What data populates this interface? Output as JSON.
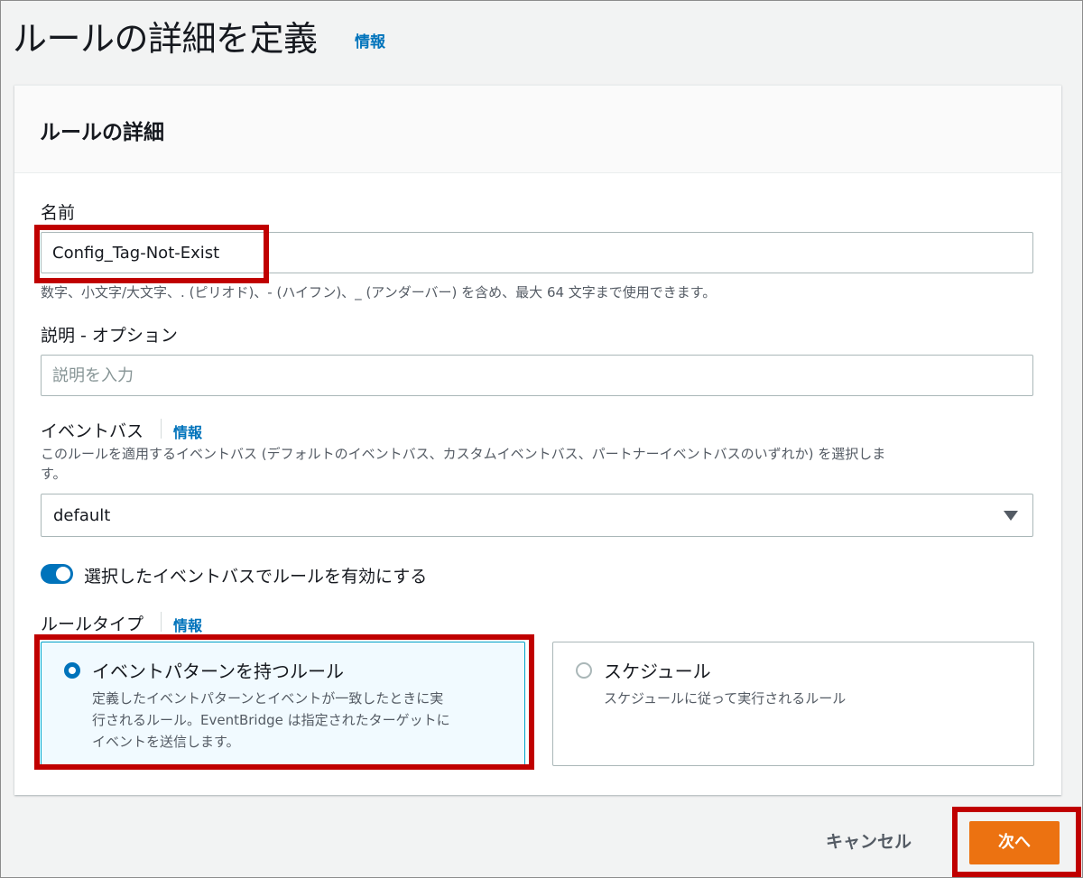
{
  "page": {
    "title": "ルールの詳細を定義",
    "info_link": "情報"
  },
  "panel": {
    "title": "ルールの詳細",
    "name": {
      "label": "名前",
      "value": "Config_Tag-Not-Exist",
      "constraint": "数字、小文字/大文字、. (ピリオド)、- (ハイフン)、_ (アンダーバー) を含め、最大 64 文字まで使用できます。"
    },
    "description": {
      "label": "説明 - オプション",
      "placeholder": "説明を入力"
    },
    "event_bus": {
      "label": "イベントバス",
      "info_link": "情報",
      "help_line1": "このルールを適用するイベントバス (デフォルトのイベントバス、カスタムイベントバス、パートナーイベントバスのいずれか) を選択しま",
      "help_line2": "す。",
      "selected": "default"
    },
    "enable_toggle": {
      "label": "選択したイベントバスでルールを有効にする",
      "checked": true
    },
    "rule_type": {
      "label": "ルールタイプ",
      "info_link": "情報",
      "options": [
        {
          "title": "イベントパターンを持つルール",
          "desc_lines": [
            "定義したイベントパターンとイベントが一致したときに実",
            "行されるルール。EventBridge は指定されたターゲットに",
            "イベントを送信します。"
          ],
          "selected": true
        },
        {
          "title": "スケジュール",
          "desc_lines": [
            "スケジュールに従って実行されるルール"
          ],
          "selected": false
        }
      ]
    }
  },
  "footer": {
    "cancel_label": "キャンセル",
    "next_label": "次へ"
  },
  "colors": {
    "accent_blue": "#0073bb",
    "primary_orange": "#ec7211",
    "highlight_red": "#c00000"
  }
}
